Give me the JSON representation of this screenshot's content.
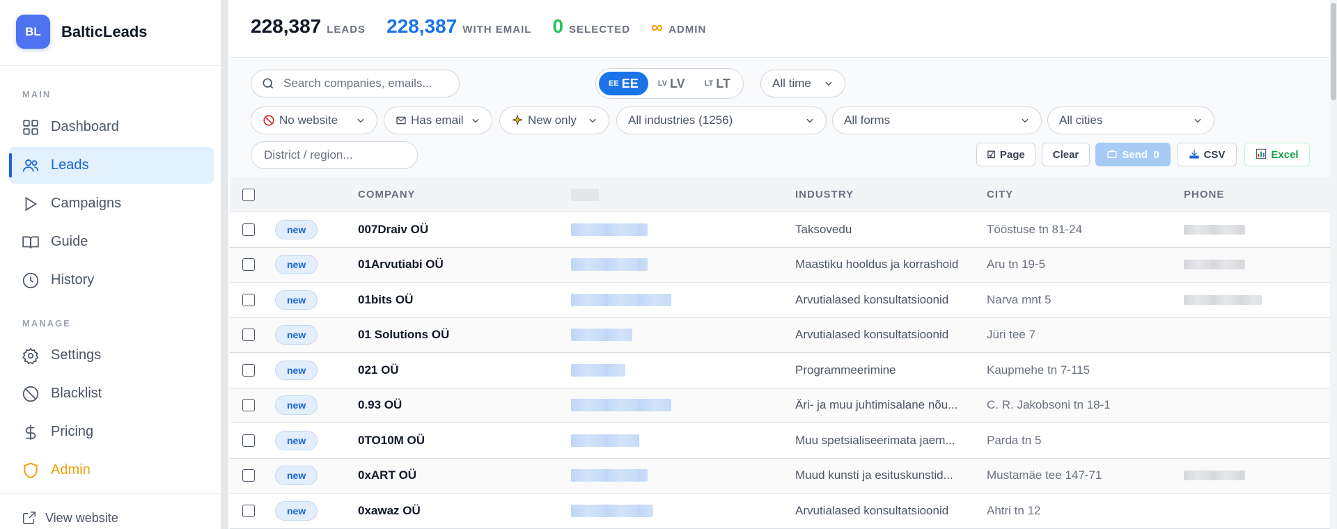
{
  "brand": {
    "initials": "BL",
    "name": "BalticLeads",
    "color": "#4f72f0"
  },
  "sidebar": {
    "sections": [
      {
        "label": "MAIN"
      },
      {
        "label": "MANAGE"
      }
    ],
    "items": [
      {
        "label": "Dashboard",
        "icon": "grid-icon"
      },
      {
        "label": "Leads",
        "icon": "users-icon",
        "active": true
      },
      {
        "label": "Campaigns",
        "icon": "play-icon"
      },
      {
        "label": "Guide",
        "icon": "book-icon"
      },
      {
        "label": "History",
        "icon": "clock-icon"
      },
      {
        "label": "Settings",
        "icon": "gear-icon"
      },
      {
        "label": "Blacklist",
        "icon": "ban-icon"
      },
      {
        "label": "Pricing",
        "icon": "dollar-icon"
      },
      {
        "label": "Admin",
        "icon": "shield-icon",
        "color": "#f59e0b"
      }
    ],
    "footer": {
      "label": "View website",
      "icon": "external-link-icon"
    }
  },
  "stats": {
    "leads": {
      "value": "228,387",
      "label": "LEADS",
      "color": "#111827"
    },
    "with_email": {
      "value": "228,387",
      "label": "WITH EMAIL",
      "color": "#1a73e8"
    },
    "selected": {
      "value": "0",
      "label": "SELECTED",
      "color": "#22c55e"
    },
    "admin": {
      "value": "∞",
      "label": "ADMIN",
      "color": "#f59e0b"
    }
  },
  "filters": {
    "search_placeholder": "Search companies, emails...",
    "countries": [
      {
        "code": "EE",
        "label": "EE",
        "active": true
      },
      {
        "code": "LV",
        "label": "LV"
      },
      {
        "code": "LT",
        "label": "LT"
      }
    ],
    "time": "All time",
    "website": "No website",
    "email": "Has email",
    "newness": "New only",
    "industries": "All industries (1256)",
    "forms": "All forms",
    "cities": "All cities",
    "district_placeholder": "District / region..."
  },
  "actions": {
    "page": "Page",
    "clear": "Clear",
    "send": "Send",
    "send_count": "0",
    "csv": "CSV",
    "excel": "Excel"
  },
  "table": {
    "columns": {
      "company": "COMPANY",
      "industry": "INDUSTRY",
      "city": "CITY",
      "phone": "PHONE"
    },
    "rows": [
      {
        "badge": "new",
        "company": "007Draiv OÜ",
        "industry": "Taksovedu",
        "city": "Tööstuse tn 81-24",
        "email_w": 0.55,
        "phone_w": 0.55
      },
      {
        "badge": "new",
        "company": "01Arvutiabi OÜ",
        "industry": "Maastiku hooldus ja korrashoid",
        "city": "Aru tn 19-5",
        "email_w": 0.55,
        "phone_w": 0.55
      },
      {
        "badge": "new",
        "company": "01bits OÜ",
        "industry": "Arvutialased konsultatsioonid",
        "city": "Narva mnt 5",
        "email_w": 0.72,
        "phone_w": 0.7
      },
      {
        "badge": "new",
        "company": "01 Solutions OÜ",
        "industry": "Arvutialased konsultatsioonid",
        "city": "Jüri tee 7",
        "email_w": 0.44,
        "phone_w": 0.0
      },
      {
        "badge": "new",
        "company": "021 OÜ",
        "industry": "Programmeerimine",
        "city": "Kaupmehe tn 7-115",
        "email_w": 0.39,
        "phone_w": 0.0
      },
      {
        "badge": "new",
        "company": "0.93 OÜ",
        "industry": "Äri- ja muu juhtimisalane nõu...",
        "city": "C. R. Jakobsoni tn 18-1",
        "email_w": 0.72,
        "phone_w": 0.0
      },
      {
        "badge": "new",
        "company": "0TO10M OÜ",
        "industry": "Muu spetsialiseerimata jaem...",
        "city": "Parda tn 5",
        "email_w": 0.49,
        "phone_w": 0.0
      },
      {
        "badge": "new",
        "company": "0xART OÜ",
        "industry": "Muud kunsti ja esituskunstid...",
        "city": "Mustamäe tee 147-71",
        "email_w": 0.55,
        "phone_w": 0.55
      },
      {
        "badge": "new",
        "company": "0xawaz OÜ",
        "industry": "Arvutialased konsultatsioonid",
        "city": "Ahtri tn 12",
        "email_w": 0.59,
        "phone_w": 0.0
      }
    ]
  }
}
